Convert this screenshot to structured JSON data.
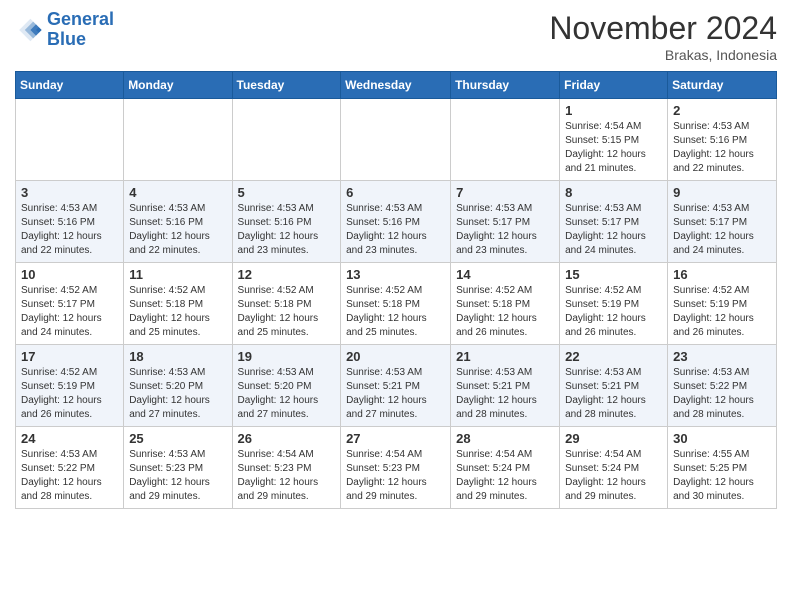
{
  "logo": {
    "line1": "General",
    "line2": "Blue"
  },
  "header": {
    "month": "November 2024",
    "location": "Brakas, Indonesia"
  },
  "weekdays": [
    "Sunday",
    "Monday",
    "Tuesday",
    "Wednesday",
    "Thursday",
    "Friday",
    "Saturday"
  ],
  "weeks": [
    [
      {
        "day": "",
        "info": ""
      },
      {
        "day": "",
        "info": ""
      },
      {
        "day": "",
        "info": ""
      },
      {
        "day": "",
        "info": ""
      },
      {
        "day": "",
        "info": ""
      },
      {
        "day": "1",
        "info": "Sunrise: 4:54 AM\nSunset: 5:15 PM\nDaylight: 12 hours\nand 21 minutes."
      },
      {
        "day": "2",
        "info": "Sunrise: 4:53 AM\nSunset: 5:16 PM\nDaylight: 12 hours\nand 22 minutes."
      }
    ],
    [
      {
        "day": "3",
        "info": "Sunrise: 4:53 AM\nSunset: 5:16 PM\nDaylight: 12 hours\nand 22 minutes."
      },
      {
        "day": "4",
        "info": "Sunrise: 4:53 AM\nSunset: 5:16 PM\nDaylight: 12 hours\nand 22 minutes."
      },
      {
        "day": "5",
        "info": "Sunrise: 4:53 AM\nSunset: 5:16 PM\nDaylight: 12 hours\nand 23 minutes."
      },
      {
        "day": "6",
        "info": "Sunrise: 4:53 AM\nSunset: 5:16 PM\nDaylight: 12 hours\nand 23 minutes."
      },
      {
        "day": "7",
        "info": "Sunrise: 4:53 AM\nSunset: 5:17 PM\nDaylight: 12 hours\nand 23 minutes."
      },
      {
        "day": "8",
        "info": "Sunrise: 4:53 AM\nSunset: 5:17 PM\nDaylight: 12 hours\nand 24 minutes."
      },
      {
        "day": "9",
        "info": "Sunrise: 4:53 AM\nSunset: 5:17 PM\nDaylight: 12 hours\nand 24 minutes."
      }
    ],
    [
      {
        "day": "10",
        "info": "Sunrise: 4:52 AM\nSunset: 5:17 PM\nDaylight: 12 hours\nand 24 minutes."
      },
      {
        "day": "11",
        "info": "Sunrise: 4:52 AM\nSunset: 5:18 PM\nDaylight: 12 hours\nand 25 minutes."
      },
      {
        "day": "12",
        "info": "Sunrise: 4:52 AM\nSunset: 5:18 PM\nDaylight: 12 hours\nand 25 minutes."
      },
      {
        "day": "13",
        "info": "Sunrise: 4:52 AM\nSunset: 5:18 PM\nDaylight: 12 hours\nand 25 minutes."
      },
      {
        "day": "14",
        "info": "Sunrise: 4:52 AM\nSunset: 5:18 PM\nDaylight: 12 hours\nand 26 minutes."
      },
      {
        "day": "15",
        "info": "Sunrise: 4:52 AM\nSunset: 5:19 PM\nDaylight: 12 hours\nand 26 minutes."
      },
      {
        "day": "16",
        "info": "Sunrise: 4:52 AM\nSunset: 5:19 PM\nDaylight: 12 hours\nand 26 minutes."
      }
    ],
    [
      {
        "day": "17",
        "info": "Sunrise: 4:52 AM\nSunset: 5:19 PM\nDaylight: 12 hours\nand 26 minutes."
      },
      {
        "day": "18",
        "info": "Sunrise: 4:53 AM\nSunset: 5:20 PM\nDaylight: 12 hours\nand 27 minutes."
      },
      {
        "day": "19",
        "info": "Sunrise: 4:53 AM\nSunset: 5:20 PM\nDaylight: 12 hours\nand 27 minutes."
      },
      {
        "day": "20",
        "info": "Sunrise: 4:53 AM\nSunset: 5:21 PM\nDaylight: 12 hours\nand 27 minutes."
      },
      {
        "day": "21",
        "info": "Sunrise: 4:53 AM\nSunset: 5:21 PM\nDaylight: 12 hours\nand 28 minutes."
      },
      {
        "day": "22",
        "info": "Sunrise: 4:53 AM\nSunset: 5:21 PM\nDaylight: 12 hours\nand 28 minutes."
      },
      {
        "day": "23",
        "info": "Sunrise: 4:53 AM\nSunset: 5:22 PM\nDaylight: 12 hours\nand 28 minutes."
      }
    ],
    [
      {
        "day": "24",
        "info": "Sunrise: 4:53 AM\nSunset: 5:22 PM\nDaylight: 12 hours\nand 28 minutes."
      },
      {
        "day": "25",
        "info": "Sunrise: 4:53 AM\nSunset: 5:23 PM\nDaylight: 12 hours\nand 29 minutes."
      },
      {
        "day": "26",
        "info": "Sunrise: 4:54 AM\nSunset: 5:23 PM\nDaylight: 12 hours\nand 29 minutes."
      },
      {
        "day": "27",
        "info": "Sunrise: 4:54 AM\nSunset: 5:23 PM\nDaylight: 12 hours\nand 29 minutes."
      },
      {
        "day": "28",
        "info": "Sunrise: 4:54 AM\nSunset: 5:24 PM\nDaylight: 12 hours\nand 29 minutes."
      },
      {
        "day": "29",
        "info": "Sunrise: 4:54 AM\nSunset: 5:24 PM\nDaylight: 12 hours\nand 29 minutes."
      },
      {
        "day": "30",
        "info": "Sunrise: 4:55 AM\nSunset: 5:25 PM\nDaylight: 12 hours\nand 30 minutes."
      }
    ]
  ]
}
